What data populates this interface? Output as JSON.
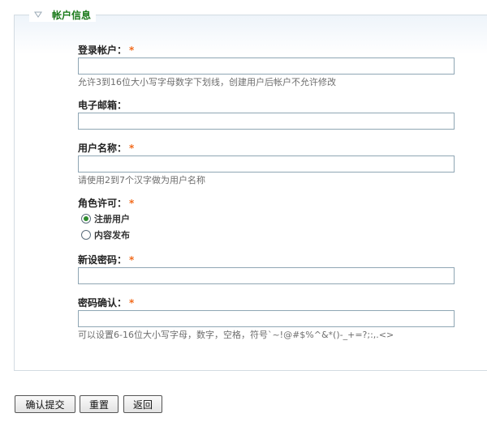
{
  "fieldset": {
    "legend": "帐户信息",
    "toggle_icon": "triangle-down-icon"
  },
  "form": {
    "login": {
      "label": "登录帐户：",
      "required": "*",
      "value": "",
      "description": "允许3到16位大小写字母数字下划线，创建用户后帐户不允许修改"
    },
    "email": {
      "label": "电子邮箱：",
      "value": ""
    },
    "username": {
      "label": "用户名称：",
      "required": "*",
      "value": "",
      "description": "请使用2到7个汉字做为用户名称"
    },
    "role": {
      "label": "角色许可：",
      "required": "*",
      "options": [
        {
          "label": "注册用户",
          "selected": true
        },
        {
          "label": "内容发布",
          "selected": false
        }
      ]
    },
    "new_password": {
      "label": "新设密码：",
      "required": "*",
      "value": ""
    },
    "confirm_password": {
      "label": "密码确认：",
      "required": "*",
      "value": "",
      "description": "可以设置6-16位大小写字母，数字，空格，符号`~!@#$%^&*()-_+=?;:,.<>"
    }
  },
  "buttons": {
    "submit": "确认提交",
    "reset": "重置",
    "back": "返回"
  },
  "colors": {
    "legend": "#1a7a1a",
    "required": "#f26a1b",
    "border": "#8fa6b4"
  }
}
